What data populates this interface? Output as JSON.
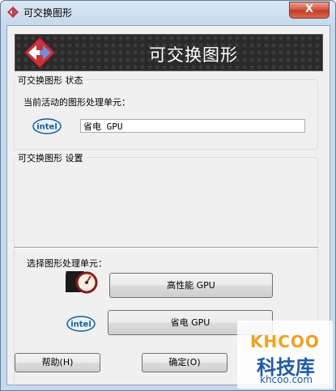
{
  "window": {
    "title": "可交换图形",
    "close_label": "X"
  },
  "banner": {
    "title": "可交换图形"
  },
  "status_group": {
    "label": "可交换图形 状态",
    "current_gpu_label": "当前活动的图形处理单元：",
    "current_gpu_value": "省电 GPU"
  },
  "settings_group": {
    "label": "可交换图形 设置",
    "select_label": "选择图形处理单元：",
    "high_perf_button": "高性能 GPU",
    "power_saving_button": "省电 GPU"
  },
  "footer": {
    "help_button": "帮助(H)",
    "ok_button": "确定(O)"
  },
  "logos": {
    "intel_text": "intel",
    "watermark_brand": "KHCOO",
    "watermark_cn": "科技库",
    "watermark_domain": "khcoo.com"
  }
}
